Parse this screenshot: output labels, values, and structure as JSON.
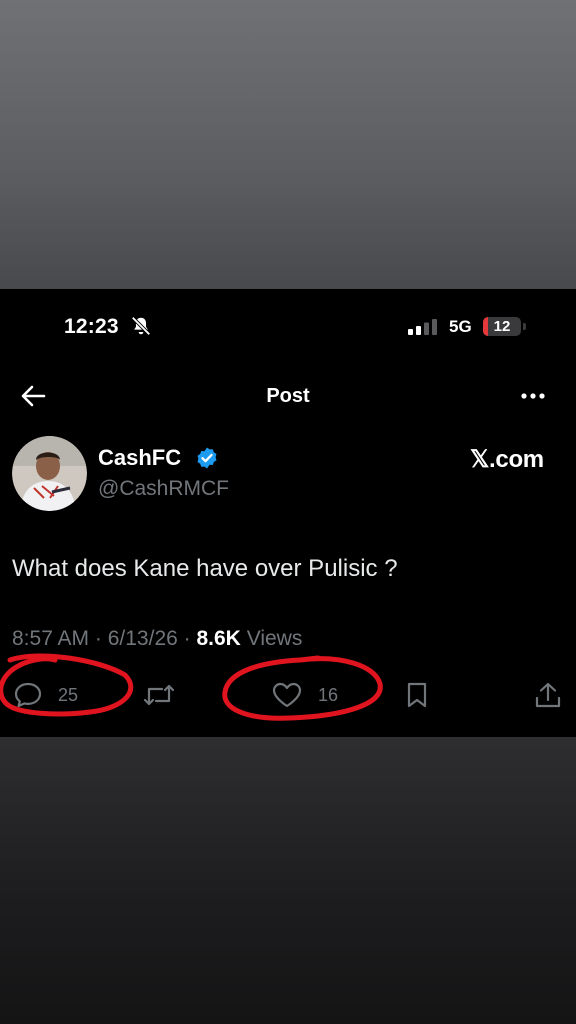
{
  "status_bar": {
    "time": "12:23",
    "network": "5G",
    "battery": "12",
    "battery_level": 0.12
  },
  "nav": {
    "title": "Post"
  },
  "author": {
    "name": "CashFC",
    "handle": "@CashRMCF",
    "verified": true,
    "source": "𝕏.com"
  },
  "tweet": {
    "text": "What does Kane have over Pulisic ?",
    "time": "8:57 AM",
    "date": "6/13/26",
    "views": "8.6K",
    "views_label": "Views"
  },
  "actions": {
    "replies": "25",
    "likes": "16"
  },
  "colors": {
    "accent": "#1d9bf0",
    "muted": "#71767b",
    "annotation": "#e0141e"
  }
}
